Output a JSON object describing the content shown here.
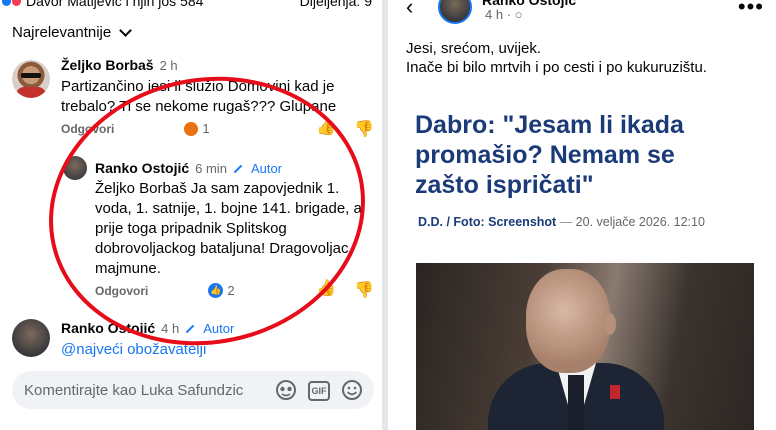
{
  "left": {
    "top_strip": {
      "names": "Davor Matijević i njih još 584",
      "shares": "Dijeljenja: 9"
    },
    "sort_label": "Najrelevantnije",
    "comments": [
      {
        "author": "Željko Borbaš",
        "time": "2 h",
        "text": "Partizančino jesi li služio Domovini kad je trebalo?  Ti se nekome rugaš??? Glupane",
        "reply_label": "Odgovori",
        "reaction_count": "1"
      },
      {
        "author": "Ranko Ostojić",
        "time": "6 min",
        "badge": "Autor",
        "text": "Željko Borbaš Ja sam zapovjednik 1. voda, 1. satnije, 1. bojne 141. brigade, a prije toga pripadnik Splitskog dobrovoljackog bataljuna! Dragovoljac majmune.",
        "reply_label": "Odgovori",
        "reaction_count": "2"
      },
      {
        "author": "Ranko Ostojić",
        "time": "4 h",
        "badge": "Autor",
        "text": "@najveći obožavatelji"
      }
    ],
    "composer": {
      "placeholder": "Komentirajte kao Luka Safundzic",
      "gif_label": "GIF"
    }
  },
  "right": {
    "author": "Ranko Ostojić",
    "time": "4 h",
    "post_text": [
      "Jesi, srećom, uvijek.",
      "Inače bi bilo mrtvih i po cesti i po kukuruzištu."
    ],
    "headline": "Dabro: \"Jesam li ikada promašio? Nemam se zašto ispričati\"",
    "byline": {
      "author": "D.D. / Foto: Screenshot",
      "separator": "—",
      "date": "20. veljače 2026. 12:10"
    }
  },
  "colors": {
    "accent": "#1877f2",
    "annotation_circle": "#e60c1a",
    "headline": "#1a3a78"
  }
}
